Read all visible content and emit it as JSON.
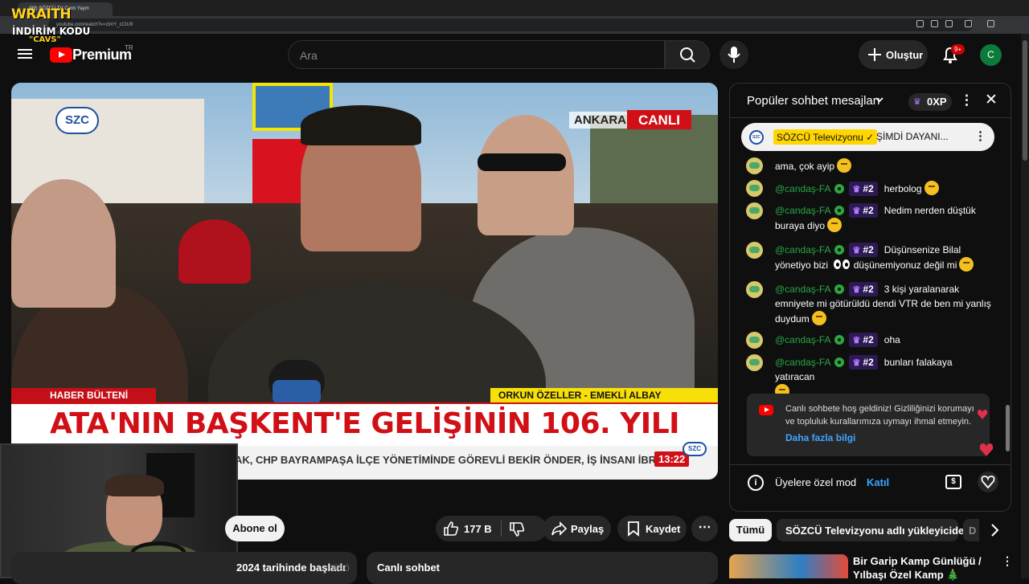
{
  "browser": {
    "tab_title": "(99) SÖZCÜ TV Canlı Yayın",
    "url": "youtube.com/watch?v=ztmY_cCtU9"
  },
  "overlay": {
    "brand": "WRAITH",
    "promo_line1": "İNDİRİM KODU",
    "promo_code": "\"CAVS\""
  },
  "header": {
    "brand": "Premium",
    "region": "TR",
    "search_placeholder": "Ara",
    "create_label": "Oluştur",
    "notifications_badge": "9+",
    "avatar_letter": "C"
  },
  "video": {
    "channel_logo": "SZC",
    "location": "ANKARA",
    "live": "CANLI",
    "program": "HABER BÜLTENİ",
    "speaker": "ORKUN ÖZELLER - EMEKLİ ALBAY",
    "headline": "ATA'NIN BAŞKENT'E GELİŞİNİN 106. YILI",
    "ticker": "AK, CHP BAYRAMPAŞA İLÇE YÖNETİMİNDE GÖREVLİ BEKİR ÖNDER, İŞ İNSANI İBRAİ",
    "time": "13:22",
    "ticker_logo": "SZC"
  },
  "actions": {
    "subscribe": "Abone ol",
    "likes": "177 B",
    "share": "Paylaş",
    "save": "Kaydet",
    "more": "⋯"
  },
  "description": {
    "text": "2024 tarihinde başladı",
    "hashtag": "#sö"
  },
  "chat_replay": "Canlı sohbet",
  "chat": {
    "title": "Popüler sohbet mesajları",
    "xp": "0XP",
    "pinned": {
      "avatar": "SZC",
      "author": "SÖZCÜ Televizyonu ✓",
      "text": "ŞİMDİ DAYANI..."
    },
    "partial_message": "ama, çok ayip",
    "messages": [
      {
        "author": "@candaş-FA",
        "rank": "#2",
        "text": "herbolog"
      },
      {
        "author": "@candaş-FA",
        "rank": "#2",
        "text": "Nedim nerden düştük buraya diyo"
      },
      {
        "author": "@candaş-FA",
        "rank": "#2",
        "text": "Düşünsenize Bilal yönetiyo bizi",
        "text2": "düşünemiyonuz değil mi"
      },
      {
        "author": "@candaş-FA",
        "rank": "#2",
        "text": "3 kişi yaralanarak emniyete mi götürüldü dendi VTR de ben mi yanlış duydum"
      },
      {
        "author": "@candaş-FA",
        "rank": "#2",
        "text": "oha"
      },
      {
        "author": "@candaş-FA",
        "rank": "#2",
        "text": "bunları falakaya yatıracan"
      }
    ],
    "welcome_text": "Canlı sohbete hoş geldiniz! Gizliliğinizi korumayı ve topluluk kurallarımıza uymayı ihmal etmeyin.",
    "welcome_link": "Daha fazla bilgi",
    "members_mode": "Üyelere özel mod",
    "join": "Katıl"
  },
  "related": {
    "chips": [
      "Tümü",
      "SÖZCÜ Televizyonu adlı yükleyiciden",
      "D"
    ],
    "video_title": "Bir Garip Kamp Günlüğü / Yılbaşı Özel Kamp 🎄"
  }
}
